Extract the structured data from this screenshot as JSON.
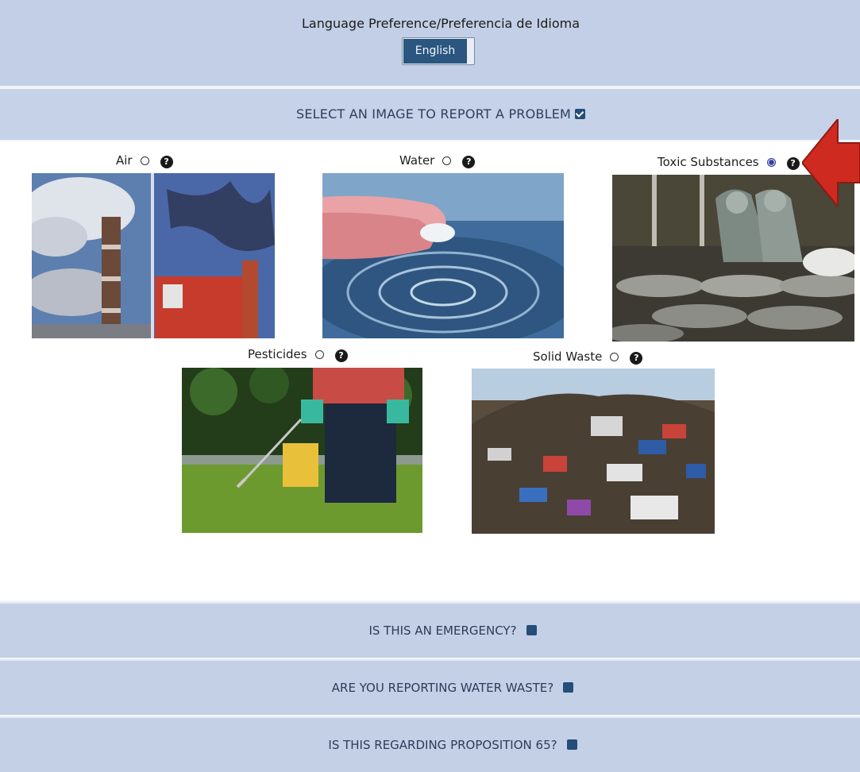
{
  "language": {
    "title": "Language Preference/Preferencia de Idioma",
    "selected": "English"
  },
  "section": {
    "title": "SELECT AN IMAGE TO REPORT A PROBLEM"
  },
  "options": [
    {
      "label": "Air",
      "selected": false
    },
    {
      "label": "Water",
      "selected": false
    },
    {
      "label": "Toxic Substances",
      "selected": true
    },
    {
      "label": "Pesticides",
      "selected": false
    },
    {
      "label": "Solid Waste",
      "selected": false
    }
  ],
  "help_glyph": "?",
  "questions": [
    {
      "label": "IS THIS AN EMERGENCY?"
    },
    {
      "label": "ARE YOU REPORTING WATER WASTE?"
    },
    {
      "label": "IS THIS REGARDING PROPOSITION 65?"
    }
  ],
  "colors": {
    "header_bar": "#c3d0e6",
    "toggle_active": "#2a5680",
    "checkbox": "#244d78",
    "arrow": "#cf2a20"
  }
}
